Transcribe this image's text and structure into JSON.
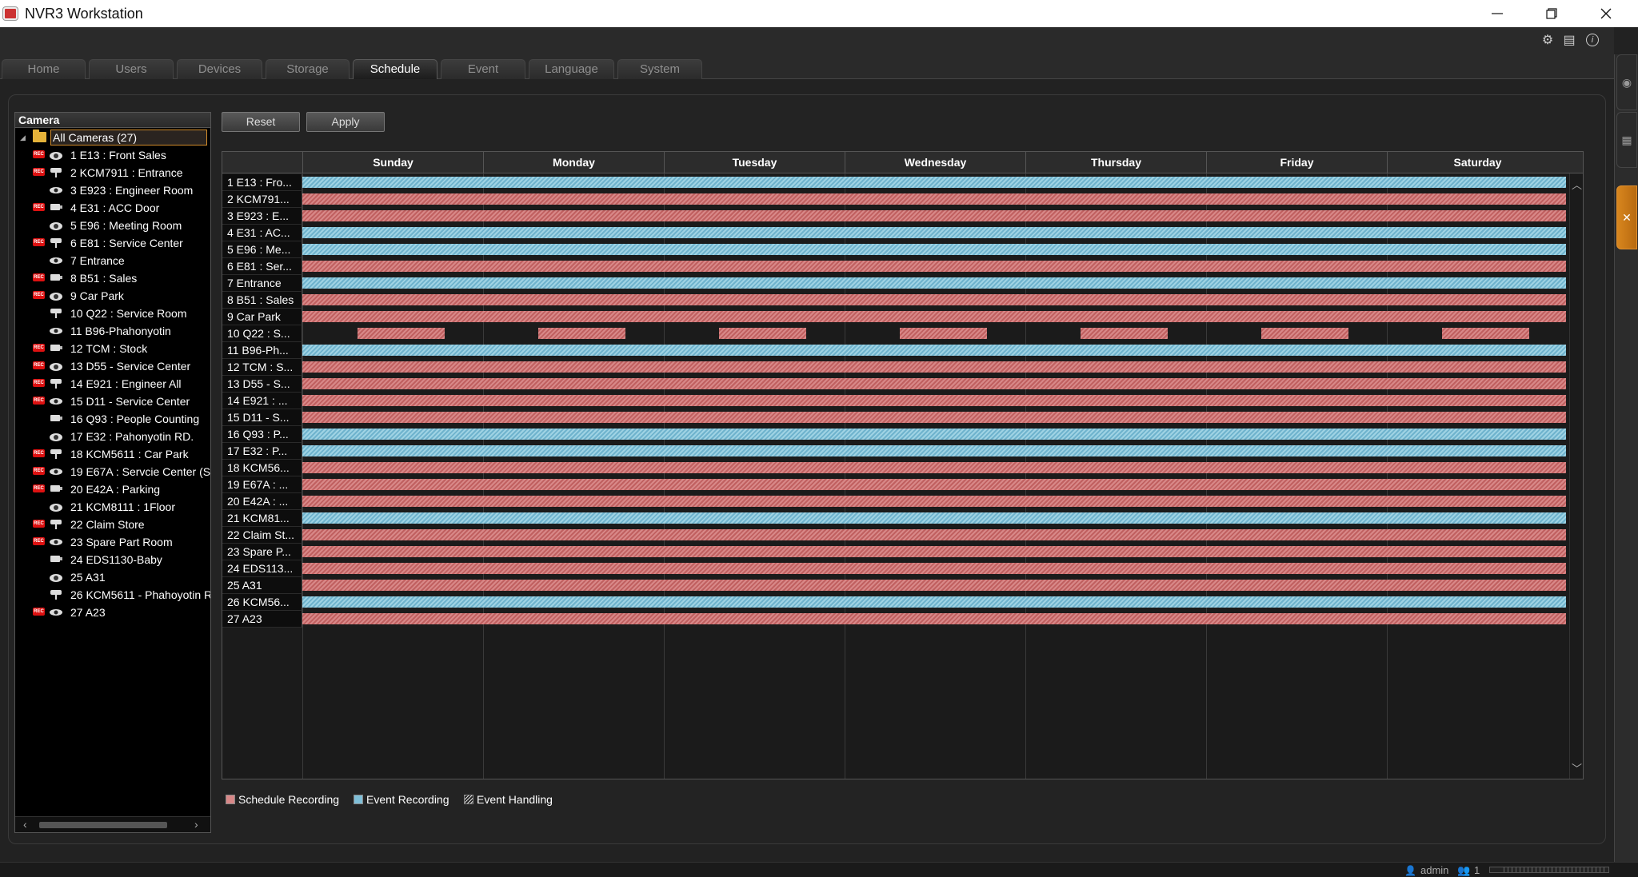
{
  "window": {
    "title": "NVR3 Workstation"
  },
  "tabs": [
    {
      "label": "Home"
    },
    {
      "label": "Users"
    },
    {
      "label": "Devices"
    },
    {
      "label": "Storage"
    },
    {
      "label": "Schedule"
    },
    {
      "label": "Event"
    },
    {
      "label": "Language"
    },
    {
      "label": "System"
    }
  ],
  "active_tab": "Schedule",
  "camera_panel": {
    "header": "Camera",
    "root": "All Cameras (27)",
    "items": [
      {
        "label": "1 E13 : Front Sales",
        "rec": true
      },
      {
        "label": "2 KCM7911 : Entrance",
        "rec": true
      },
      {
        "label": "3 E923 : Engineer Room",
        "rec": false
      },
      {
        "label": "4 E31 : ACC Door",
        "rec": true
      },
      {
        "label": "5 E96 : Meeting Room",
        "rec": false
      },
      {
        "label": "6 E81 : Service Center",
        "rec": true
      },
      {
        "label": "7 Entrance",
        "rec": false
      },
      {
        "label": "8 B51 : Sales",
        "rec": true
      },
      {
        "label": "9 Car Park",
        "rec": true
      },
      {
        "label": "10 Q22 : Service Room",
        "rec": false
      },
      {
        "label": "11 B96-Phahonyotin",
        "rec": false
      },
      {
        "label": "12 TCM : Stock",
        "rec": true
      },
      {
        "label": "13 D55 - Service Center",
        "rec": true
      },
      {
        "label": "14 E921 : Engineer All",
        "rec": true
      },
      {
        "label": "15 D11 - Service Center",
        "rec": true
      },
      {
        "label": "16 Q93 : People Counting",
        "rec": false
      },
      {
        "label": "17 E32 : Pahonyotin RD.",
        "rec": false
      },
      {
        "label": "18 KCM5611 : Car Park",
        "rec": true
      },
      {
        "label": "19 E67A : Servcie Center (S",
        "rec": true
      },
      {
        "label": "20 E42A : Parking",
        "rec": true
      },
      {
        "label": "21 KCM8111 : 1Floor",
        "rec": false
      },
      {
        "label": "22 Claim Store",
        "rec": true
      },
      {
        "label": "23 Spare Part Room",
        "rec": true
      },
      {
        "label": "24 EDS1130-Baby",
        "rec": false
      },
      {
        "label": "25 A31",
        "rec": false
      },
      {
        "label": "26 KCM5611 - Phahoyotin R",
        "rec": false
      },
      {
        "label": "27 A23",
        "rec": true
      }
    ]
  },
  "buttons": {
    "reset": "Reset",
    "apply": "Apply"
  },
  "days": [
    "Sunday",
    "Monday",
    "Tuesday",
    "Wednesday",
    "Thursday",
    "Friday",
    "Saturday"
  ],
  "schedule_rows": [
    {
      "label": "1 E13 : Fro...",
      "type": "event"
    },
    {
      "label": "2 KCM791...",
      "type": "schedule"
    },
    {
      "label": "3 E923 : E...",
      "type": "schedule"
    },
    {
      "label": "4 E31 : AC...",
      "type": "event"
    },
    {
      "label": "5 E96 : Me...",
      "type": "event"
    },
    {
      "label": "6 E81 : Ser...",
      "type": "schedule"
    },
    {
      "label": "7 Entrance",
      "type": "event"
    },
    {
      "label": "8 B51 : Sales",
      "type": "schedule"
    },
    {
      "label": "9 Car Park",
      "type": "schedule"
    },
    {
      "label": "10 Q22 : S...",
      "type": "partial"
    },
    {
      "label": "11 B96-Ph...",
      "type": "event"
    },
    {
      "label": "12 TCM : S...",
      "type": "schedule"
    },
    {
      "label": "13 D55 - S...",
      "type": "schedule"
    },
    {
      "label": "14 E921 : ...",
      "type": "schedule"
    },
    {
      "label": "15 D11 - S...",
      "type": "schedule"
    },
    {
      "label": "16 Q93 : P...",
      "type": "event"
    },
    {
      "label": "17 E32 : P...",
      "type": "event"
    },
    {
      "label": "18 KCM56...",
      "type": "schedule"
    },
    {
      "label": "19 E67A : ...",
      "type": "schedule"
    },
    {
      "label": "20 E42A : ...",
      "type": "schedule"
    },
    {
      "label": "21 KCM81...",
      "type": "event"
    },
    {
      "label": "22 Claim St...",
      "type": "schedule"
    },
    {
      "label": "23 Spare P...",
      "type": "schedule"
    },
    {
      "label": "24 EDS113...",
      "type": "schedule"
    },
    {
      "label": "25 A31",
      "type": "schedule"
    },
    {
      "label": "26 KCM56...",
      "type": "event"
    },
    {
      "label": "27 A23",
      "type": "schedule"
    }
  ],
  "legend": {
    "schedule": "Schedule Recording",
    "event": "Event Recording",
    "handling": "Event Handling"
  },
  "colors": {
    "schedule": "#d88888",
    "event": "#7fbfd8",
    "accent": "#d8861e"
  },
  "status": {
    "user": "admin",
    "count": "1"
  }
}
